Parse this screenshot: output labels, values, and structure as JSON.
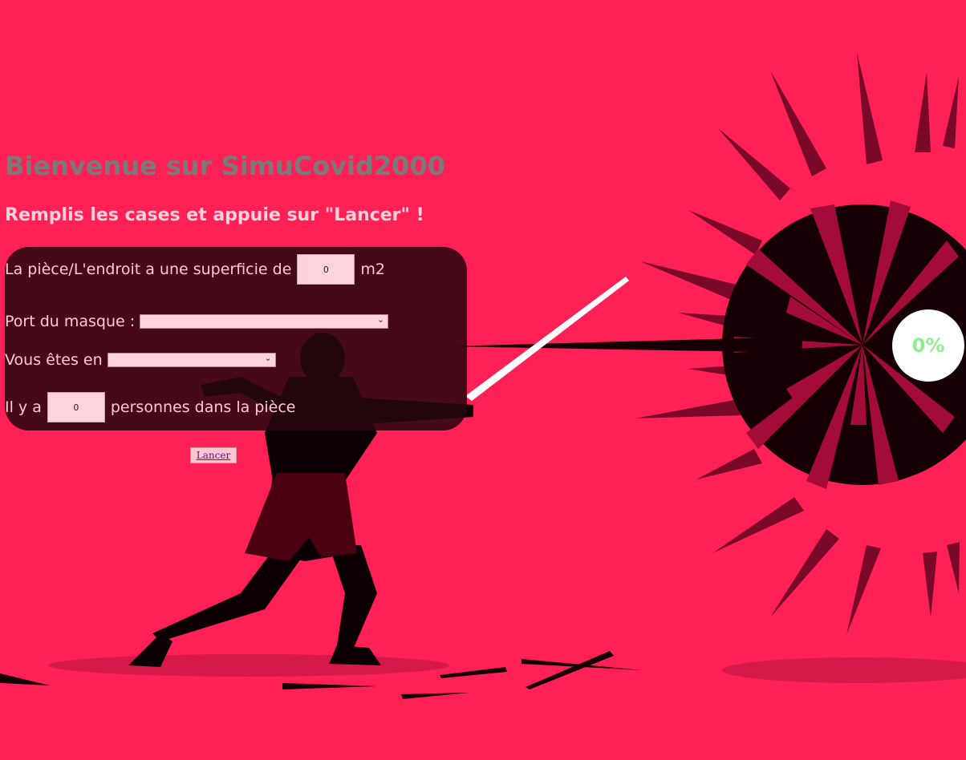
{
  "header": {
    "title": "Bienvenue sur SimuCovid2000",
    "instruction": "Remplis les cases et appuie sur \"Lancer\" !"
  },
  "form": {
    "surface": {
      "label_before": "La pièce/L'endroit a une superficie de",
      "value": "0",
      "unit": "m2"
    },
    "mask": {
      "label": "Port du masque :",
      "selected": ""
    },
    "status": {
      "label": "Vous êtes en",
      "selected": ""
    },
    "people": {
      "label_before": "Il y a",
      "value": "0",
      "label_after": "personnes dans la pièce"
    },
    "launch_label": "Lancer"
  },
  "progress": {
    "value": 0,
    "label": "0%"
  },
  "colors": {
    "background": "#ff2155",
    "title": "#7b7b7b",
    "progress_text": "#90ee90"
  },
  "icons": {
    "select_arrow": "chevron-down-icon"
  }
}
